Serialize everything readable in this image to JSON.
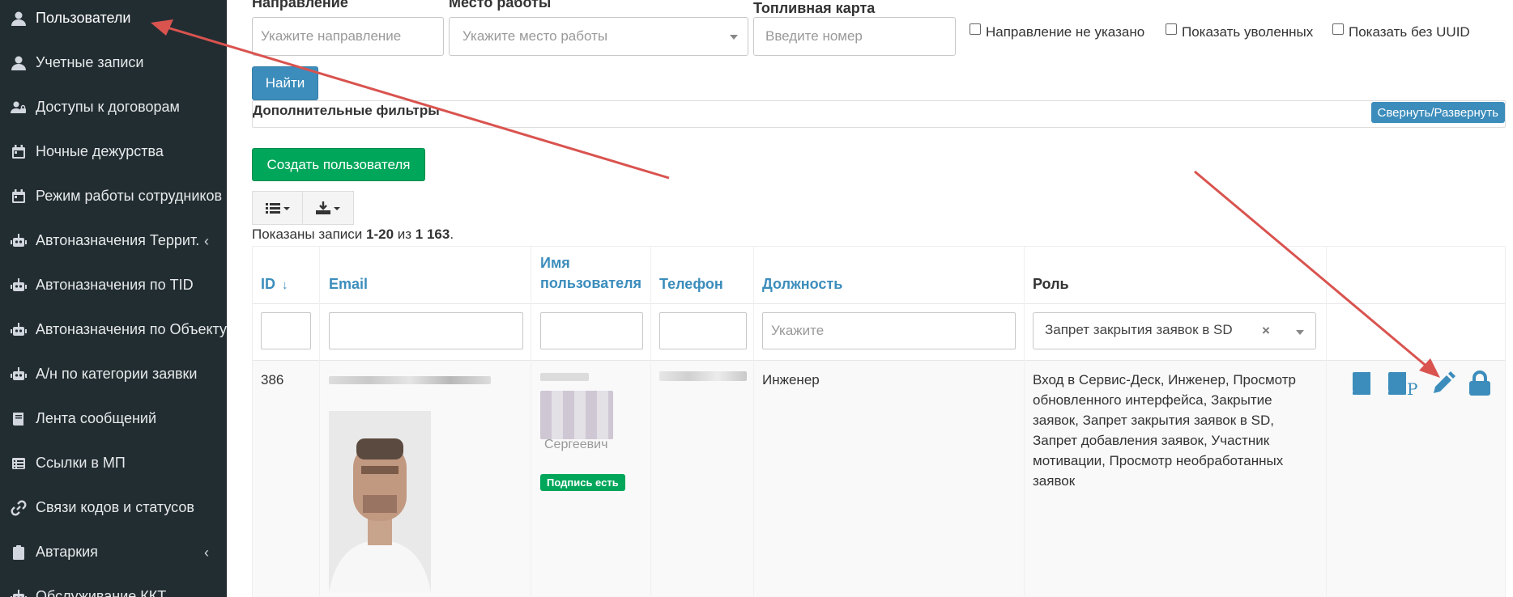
{
  "sidebar": {
    "items": [
      {
        "label": "Пользователи",
        "icon": "user-icon",
        "active": true
      },
      {
        "label": "Учетные записи",
        "icon": "user-icon"
      },
      {
        "label": "Доступы к договорам",
        "icon": "users-lock-icon"
      },
      {
        "label": "Ночные дежурства",
        "icon": "calendar-icon"
      },
      {
        "label": "Режим работы сотрудников",
        "icon": "calendar-icon"
      },
      {
        "label": "Автоназначения Террит.",
        "icon": "robot-icon",
        "chevron": true
      },
      {
        "label": "Автоназначения по TID",
        "icon": "robot-icon"
      },
      {
        "label": "Автоназначения по Объекту",
        "icon": "robot-icon"
      },
      {
        "label": "А/н по категории заявки",
        "icon": "robot-icon"
      },
      {
        "label": "Лента сообщений",
        "icon": "book-icon"
      },
      {
        "label": "Ссылки в МП",
        "icon": "list-icon"
      },
      {
        "label": "Связи кодов и статусов",
        "icon": "link-icon"
      },
      {
        "label": "Автаркия",
        "icon": "clipboard-icon",
        "chevron": true
      },
      {
        "label": "Обслуживание ККТ",
        "icon": "robot-icon"
      }
    ]
  },
  "filters": {
    "direction_label": "Направление",
    "direction_placeholder": "Укажите направление",
    "workplace_label": "Место работы",
    "workplace_placeholder": "Укажите место работы",
    "fuelcard_label": "Топливная карта",
    "fuelcard_placeholder": "Введите номер",
    "cb_no_direction": "Направление не указано",
    "cb_show_fired": "Показать уволенных",
    "cb_no_uuid": "Показать без UUID",
    "find_button": "Найти",
    "additional_title": "Дополнительные фильтры",
    "collapse_button": "Свернуть/Развернуть"
  },
  "create_button": "Создать пользователя",
  "summary": {
    "prefix": "Показаны записи ",
    "range": "1-20",
    "middle": " из ",
    "total": "1 163",
    "suffix": "."
  },
  "table": {
    "headers": {
      "id": "ID",
      "email": "Email",
      "username_1": "Имя",
      "username_2": "пользователя",
      "phone": "Телефон",
      "position": "Должность",
      "role": "Роль"
    },
    "filter_position_placeholder": "Укажите",
    "filter_role_value": "Запрет закрытия заявок в SD",
    "rows": [
      {
        "id": "386",
        "name_fragment": "Сергеевич",
        "badge": "Подпись есть",
        "position": "Инженер",
        "roles": [
          "Вход в Сервис-Деск, Инженер, Просмотр",
          "обновленного интерфейса, Закрытие",
          "заявок, Запрет закрытия заявок в SD,",
          "Запрет добавления заявок, Участник",
          "мотивации, Просмотр необработанных",
          "заявок"
        ]
      }
    ]
  },
  "colors": {
    "sidebar_bg": "#222d32",
    "primary": "#3c8dbc",
    "success": "#00a65a",
    "annotation_arrow": "#d9534f"
  }
}
